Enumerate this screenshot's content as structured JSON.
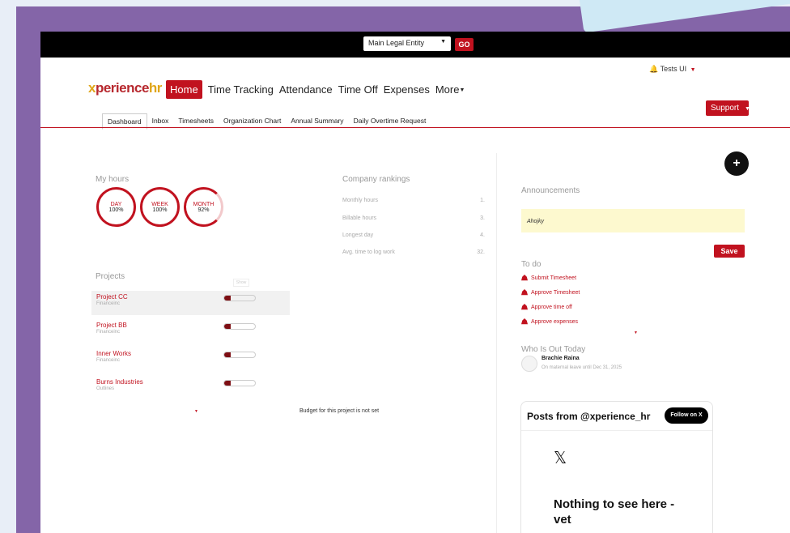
{
  "topbar": {
    "entity_select": "Main Legal Entity",
    "go_label": "GO"
  },
  "user": {
    "name": "Tests UI"
  },
  "logo": {
    "prefix": "x",
    "middle": "perience",
    "suffix": "hr"
  },
  "nav": {
    "home": "Home",
    "time_tracking": "Time Tracking",
    "attendance": "Attendance",
    "time_off": "Time Off",
    "expenses": "Expenses",
    "more": "More"
  },
  "support_label": "Support",
  "subnav": {
    "dashboard": "Dashboard",
    "inbox": "Inbox",
    "timesheets": "Timesheets",
    "org_chart": "Organization Chart",
    "annual_summary": "Annual Summary",
    "daily_overtime": "Daily Overtime Request"
  },
  "my_hours": {
    "title": "My hours",
    "day": {
      "label": "DAY",
      "value": "100%"
    },
    "week": {
      "label": "WEEK",
      "value": "100%"
    },
    "month": {
      "label": "MONTH",
      "value": "92%"
    }
  },
  "rankings": {
    "title": "Company rankings",
    "rows": [
      {
        "label": "Monthly hours",
        "value": "1."
      },
      {
        "label": "Billable hours",
        "value": "3."
      },
      {
        "label": "Longest day",
        "value": "4."
      },
      {
        "label": "Avg. time to log work",
        "value": "32."
      }
    ]
  },
  "projects": {
    "title": "Projects",
    "show_label": "Show",
    "items": [
      {
        "name": "Project CC",
        "client": "Financeinc",
        "progress": 0.2
      },
      {
        "name": "Project BB",
        "client": "Financeinc",
        "progress": 0.2
      },
      {
        "name": "Inner Works",
        "client": "Financeinc",
        "progress": 0.2
      },
      {
        "name": "Burns Industries",
        "client": "Outlines",
        "progress": 0.2
      }
    ],
    "budget_note": "Budget for this project is not set"
  },
  "announcements": {
    "title": "Announcements",
    "text": "Ahojky",
    "save_label": "Save"
  },
  "todo": {
    "title": "To do",
    "items": [
      "Submit Timesheet",
      "Approve Timesheet",
      "Approve time off",
      "Approve expenses"
    ]
  },
  "out_today": {
    "title": "Who Is Out Today",
    "name": "Brachie Raina",
    "detail": "On maternal leave until Dec 31, 2025"
  },
  "x_widget": {
    "title": "Posts from @xperience_hr",
    "follow_label": "Follow on X",
    "logo": "𝕏",
    "empty": "Nothing to see here - vet"
  },
  "plus_label": "+"
}
